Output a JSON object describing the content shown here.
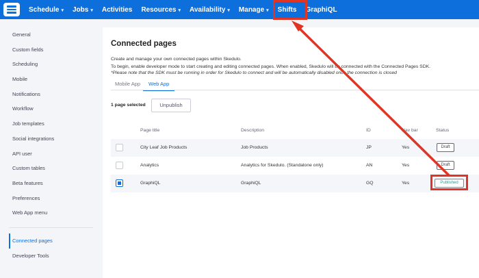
{
  "nav": {
    "items": [
      {
        "label": "Schedule",
        "caret": true
      },
      {
        "label": "Jobs",
        "caret": true
      },
      {
        "label": "Activities",
        "caret": false
      },
      {
        "label": "Resources",
        "caret": true
      },
      {
        "label": "Availability",
        "caret": true
      },
      {
        "label": "Manage",
        "caret": true
      },
      {
        "label": "Shifts",
        "caret": false
      },
      {
        "label": "GraphiQL",
        "caret": false
      }
    ],
    "caret": "▾"
  },
  "sidebar": {
    "items": [
      "General",
      "Custom fields",
      "Scheduling",
      "Mobile",
      "Notifications",
      "Workflow",
      "Job templates",
      "Social integrations",
      "API user",
      "Custom tables",
      "Beta features",
      "Preferences",
      "Web App menu"
    ],
    "bottom": [
      "Connected pages",
      "Developer Tools"
    ]
  },
  "main": {
    "title": "Connected pages",
    "desc1": "Create and manage your own connected pages within Skedulo.",
    "desc2": "To begin, enable developer mode to start creating and editing connected pages. When enabled, Skedulo will be connected with the Connected Pages SDK.",
    "note": "*Please note that the SDK must be running in order for Skedulo to connect and will be automatically disabled once the connection is closed",
    "tabs": [
      "Mobile App",
      "Web App"
    ],
    "selected": "1 page selected",
    "unpublish": "Unpublish",
    "columns": [
      "Page title",
      "Description",
      "ID",
      "Nav bar",
      "Status"
    ],
    "rows": [
      {
        "title": "City Leaf Job Products",
        "description": "Job Products",
        "id": "JP",
        "nav": "Yes",
        "status": "Draft",
        "checked": false
      },
      {
        "title": "Analytics",
        "description": "Analytics for Skedulo. (Standalone only)",
        "id": "AN",
        "nav": "Yes",
        "status": "Draft",
        "checked": false
      },
      {
        "title": "GraphiQL",
        "description": "GraphiQL",
        "id": "GQ",
        "nav": "Yes",
        "status": "Published",
        "checked": true
      }
    ]
  },
  "colors": {
    "brand": "#0d6fdc",
    "annotation": "#e03424"
  }
}
